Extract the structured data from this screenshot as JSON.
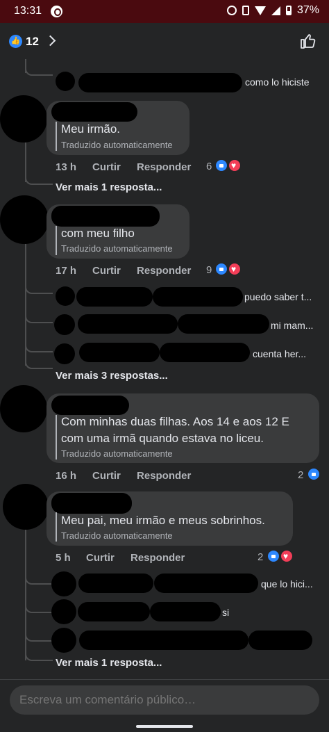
{
  "status_bar": {
    "time": "13:31",
    "battery": "37%",
    "icons": [
      "whatsapp-icon",
      "alarm-icon",
      "vibrate-icon",
      "wifi-icon",
      "signal-icon",
      "battery-icon"
    ]
  },
  "header": {
    "reaction_count": "12",
    "icons": [
      "like-reaction-icon",
      "chevron-right-icon",
      "thumbs-up-outline-icon"
    ]
  },
  "colors": {
    "background": "#242526",
    "bubble": "#3a3b3c",
    "like_blue": "#2d88ff",
    "love_red": "#f33e58",
    "status_bar": "#4a0a0f"
  },
  "comments": [
    {
      "text": "Meu irmão.",
      "translated": "Traduzido automaticamente",
      "time": "13 h",
      "like_label": "Curtir",
      "reply_label": "Responder",
      "reactions": "6",
      "more_replies": "Ver mais 1 resposta..."
    },
    {
      "text": "com meu filho",
      "translated": "Traduzido automaticamente",
      "time": "17 h",
      "like_label": "Curtir",
      "reply_label": "Responder",
      "reactions": "9",
      "replies": [
        "puedo saber t...",
        "mi mam...",
        "cuenta  her..."
      ],
      "more_replies": "Ver mais 3 respostas..."
    },
    {
      "text_line1": "Com minhas duas filhas. Aos 14 e aos 12 E",
      "text_line2": "com uma irmã quando estava no liceu.",
      "translated": "Traduzido automaticamente",
      "time": "16 h",
      "like_label": "Curtir",
      "reply_label": "Responder",
      "reactions": "2"
    },
    {
      "text": "Meu pai, meu irmão e meus sobrinhos.",
      "translated": "Traduzido automaticamente",
      "time": "5 h",
      "like_label": "Curtir",
      "reply_label": "Responder",
      "reactions": "2",
      "replies": [
        "que lo hici...",
        "si"
      ],
      "more_replies": "Ver mais 1 resposta..."
    }
  ],
  "top_reply": "como lo hiciste",
  "composer": {
    "placeholder": "Escreva um comentário público…"
  }
}
